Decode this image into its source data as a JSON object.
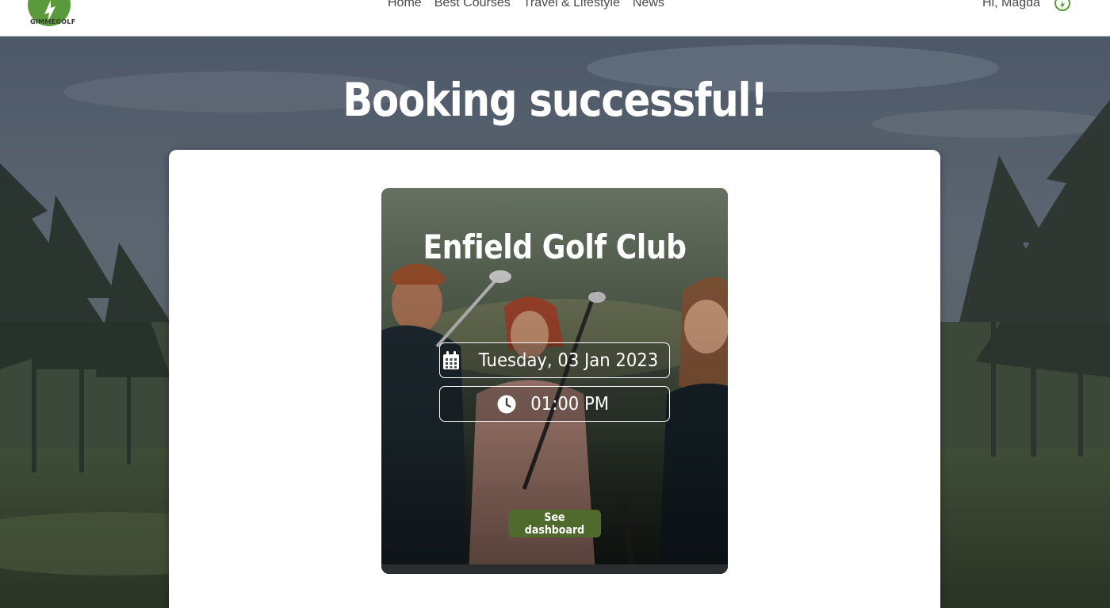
{
  "header": {
    "logo_text": "GIMMEGOLF",
    "nav": [
      "Home",
      "Best Courses",
      "Travel & Lifestyle",
      "News"
    ],
    "greeting": "Hi, Magda"
  },
  "page": {
    "title": "Booking successful!"
  },
  "booking": {
    "club_name": "Enfield Golf Club",
    "date": "Tuesday, 03 Jan 2023",
    "time": "01:00 PM",
    "button_label": "See dashboard"
  },
  "colors": {
    "brand_green": "#5a9a3c",
    "button_green": "#4f6a2c"
  },
  "icons": {
    "logo": "golf-logo-icon",
    "user": "user-avatar-icon",
    "date": "calendar-icon",
    "time": "clock-icon"
  }
}
